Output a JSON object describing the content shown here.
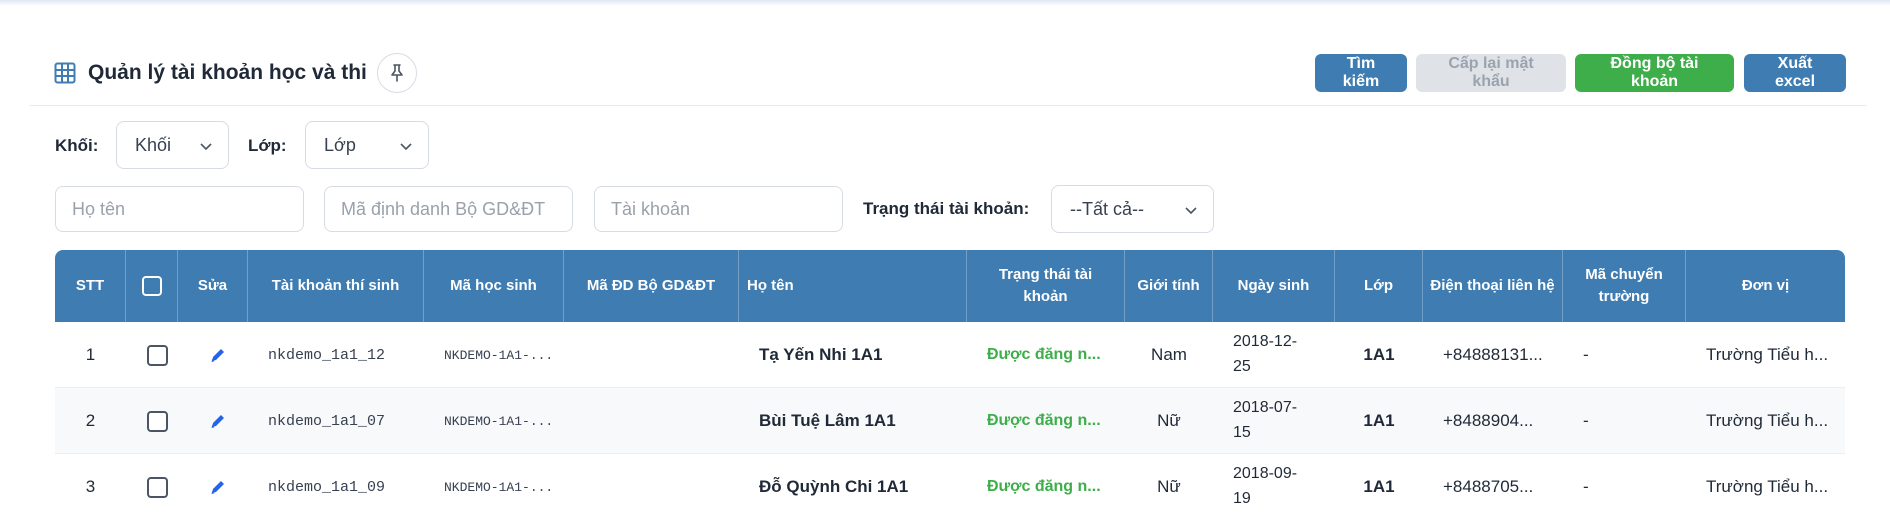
{
  "header": {
    "title": "Quản lý tài khoản học và thi",
    "buttons": {
      "search": "Tìm kiếm",
      "reset_password": "Cấp lại mật khẩu",
      "sync_accounts": "Đồng bộ tài khoản",
      "export_excel": "Xuất excel"
    }
  },
  "filters": {
    "grade_label": "Khối:",
    "grade_value": "Khối",
    "class_label": "Lớp:",
    "class_value": "Lớp",
    "name_placeholder": "Họ tên",
    "moet_id_placeholder": "Mã định danh Bộ GD&ĐT",
    "account_placeholder": "Tài khoản",
    "status_label": "Trạng thái tài khoản:",
    "status_value": "--Tất cả--"
  },
  "table": {
    "columns": {
      "stt": "STT",
      "edit": "Sửa",
      "account": "Tài khoản thí sinh",
      "student_code": "Mã học sinh",
      "moet_code": "Mã ĐD Bộ GD&ĐT",
      "name": "Họ tên",
      "status": "Trạng thái tài khoản",
      "gender": "Giới tính",
      "dob": "Ngày sinh",
      "class": "Lớp",
      "phone": "Điện thoại liên hệ",
      "transfer": "Mã chuyển trường",
      "unit": "Đơn vị"
    },
    "rows": [
      {
        "stt": "1",
        "account": "nkdemo_1a1_12",
        "student_code": "NKDEMO-1A1-...",
        "moet_code": "",
        "name": "Tạ Yến Nhi 1A1",
        "status": "Được đăng n...",
        "gender": "Nam",
        "dob_line1": "2018-12-",
        "dob_line2": "25",
        "class": "1A1",
        "phone": "+84888131...",
        "transfer": "-",
        "unit": "Trường Tiểu h..."
      },
      {
        "stt": "2",
        "account": "nkdemo_1a1_07",
        "student_code": "NKDEMO-1A1-...",
        "moet_code": "",
        "name": "Bùi Tuệ Lâm 1A1",
        "status": "Được đăng n...",
        "gender": "Nữ",
        "dob_line1": "2018-07-",
        "dob_line2": "15",
        "class": "1A1",
        "phone": "+8488904...",
        "transfer": "-",
        "unit": "Trường Tiểu h..."
      },
      {
        "stt": "3",
        "account": "nkdemo_1a1_09",
        "student_code": "NKDEMO-1A1-...",
        "moet_code": "",
        "name": "Đỗ Quỳnh Chi 1A1",
        "status": "Được đăng n...",
        "gender": "Nữ",
        "dob_line1": "2018-09-",
        "dob_line2": "19",
        "class": "1A1",
        "phone": "+8488705...",
        "transfer": "-",
        "unit": "Trường Tiểu h..."
      }
    ]
  },
  "icons": {
    "title_icon": "grid-table-icon",
    "pin": "pin-icon",
    "dropdown": "chevron-down-icon",
    "edit": "pencil-icon"
  },
  "colors": {
    "primary": "#3f7cb2",
    "success": "#3eae4a",
    "disabled": "#dfe3e8"
  }
}
